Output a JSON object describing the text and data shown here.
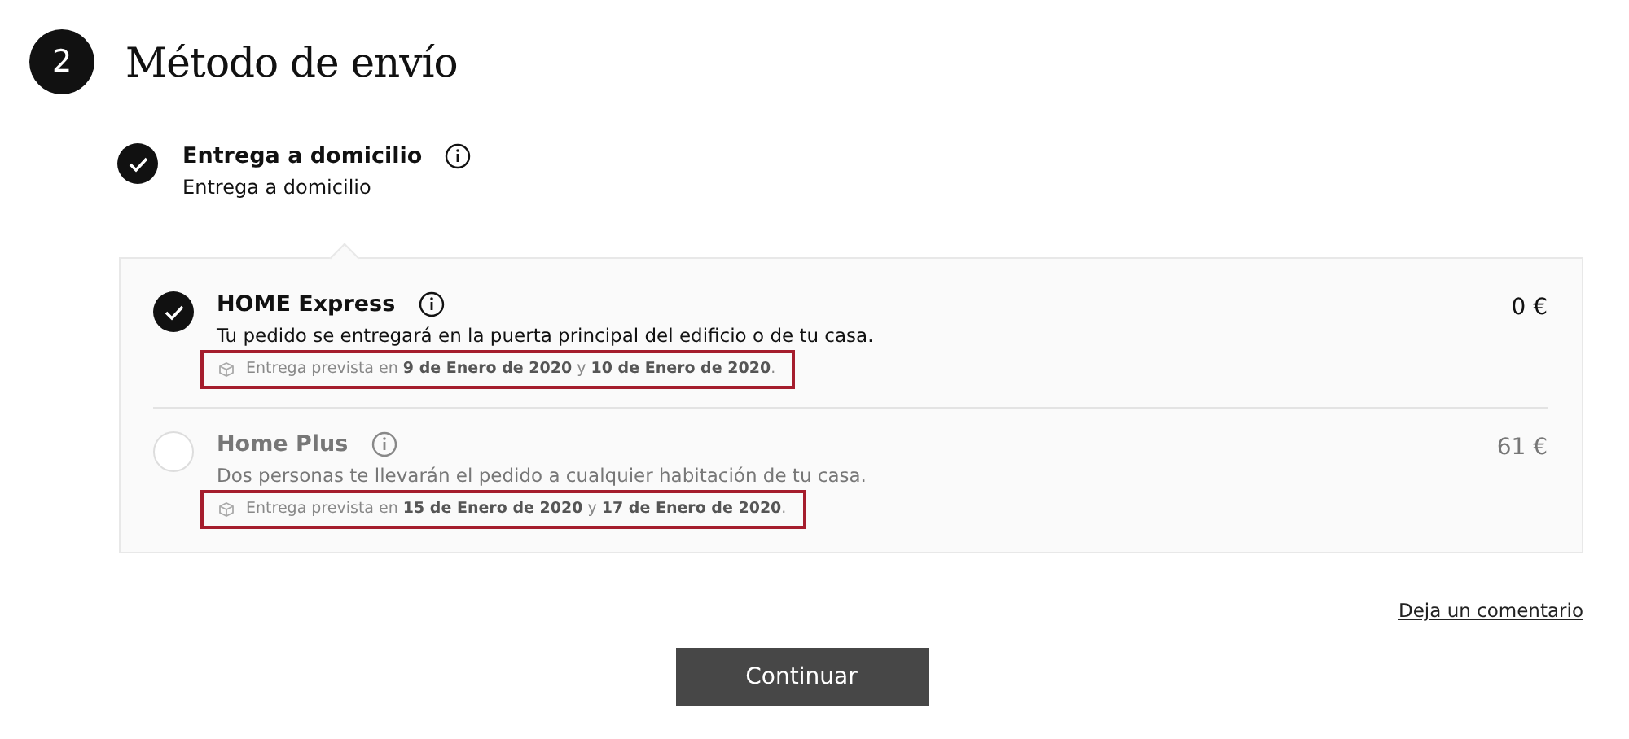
{
  "step": {
    "number": "2",
    "title": "Método de envío"
  },
  "delivery_type": {
    "title": "Entrega a domicilio",
    "subtitle": "Entrega a domicilio",
    "selected": true
  },
  "options": [
    {
      "name": "HOME Express",
      "description": "Tu pedido se entregará en la puerta principal del edificio o de tu casa.",
      "estimate": "Entrega prevista en **9 de Enero de 2020** y **10 de Enero de 2020**.",
      "price": "0 €",
      "selected": true,
      "highlighted": true
    },
    {
      "name": "Home Plus",
      "description": "Dos personas te llevarán el pedido a cualquier habitación de tu casa.",
      "estimate": "Entrega prevista en **15 de Enero de 2020** y **17 de Enero de 2020**.",
      "price": "61 €",
      "selected": false,
      "highlighted": true
    }
  ],
  "comment_link": "Deja un comentario",
  "continue_button": "Continuar"
}
